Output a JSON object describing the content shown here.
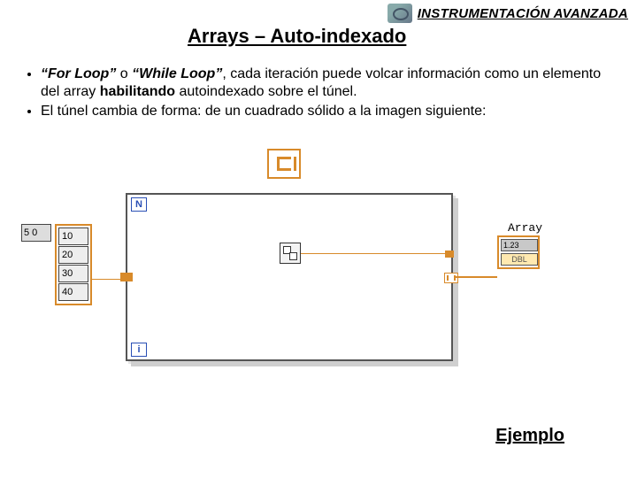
{
  "header": {
    "brand": "INSTRUMENTACIÓN AVANZADA"
  },
  "title": "Arrays – Auto-indexado",
  "bullets": {
    "b1": {
      "lead": "“For Loop”",
      "mid1": " o ",
      "wl": "“While Loop”",
      "mid2": ", cada iteración puede volcar información como un elemento del array ",
      "hab": "habilitando",
      "tail": " autoindexado sobre el túnel."
    },
    "b2": "El túnel cambia de forma: de un cuadrado sólido a la imagen siguiente:"
  },
  "diagram": {
    "sizeControl": "5  0",
    "inputArray": [
      "10",
      "20",
      "30",
      "40"
    ],
    "Nlabel": "N",
    "iLabel": "i",
    "outputTitle": "Array",
    "outputHeader": "1.23",
    "outputRow": "DBL"
  },
  "footer": {
    "example": "Ejemplo"
  }
}
